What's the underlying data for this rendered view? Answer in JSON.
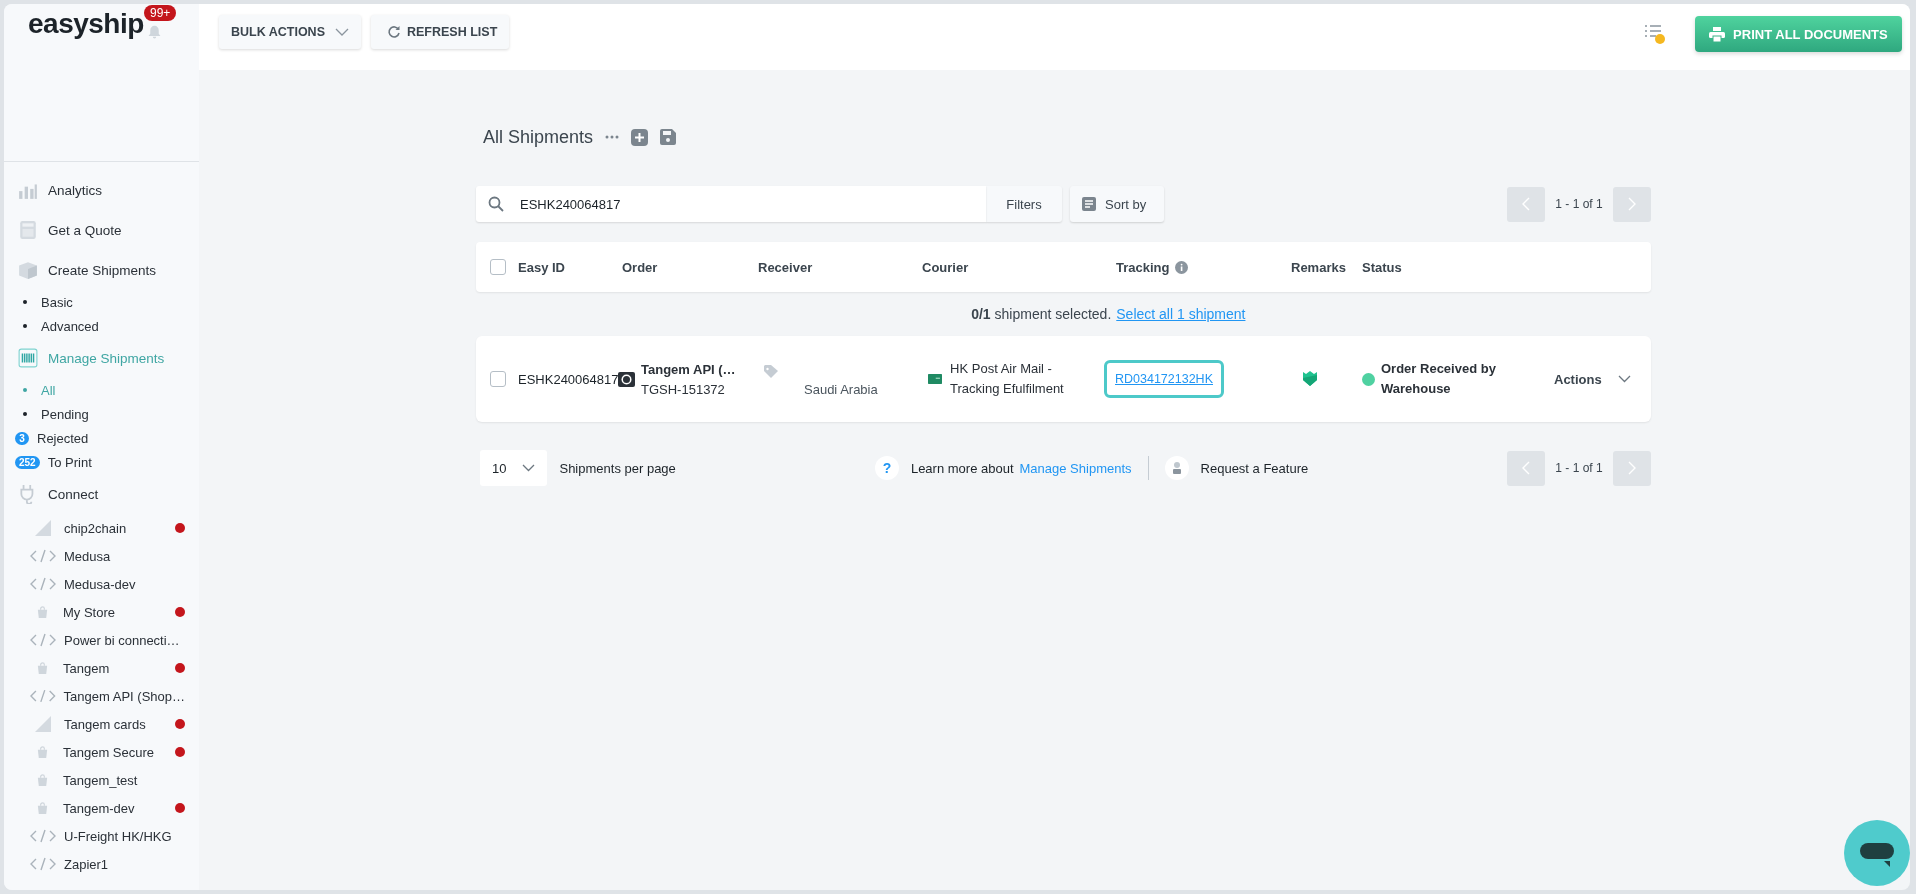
{
  "brand": {
    "logo": "easyship",
    "notification_badge": "99+"
  },
  "toolbar": {
    "buttons": [
      {
        "label": "BULK ACTIONS",
        "kind": "dropdown"
      },
      {
        "label": "REFRESH LIST",
        "kind": "refresh"
      }
    ],
    "print_button": "PRINT ALL DOCUMENTS"
  },
  "sidebar": {
    "nav": [
      {
        "label": "Analytics",
        "kind": "section",
        "selected": false
      },
      {
        "label": "Get a Quote",
        "kind": "section",
        "selected": false
      },
      {
        "label": "Create Shipments",
        "kind": "section",
        "selected": false
      },
      {
        "label": "Basic",
        "kind": "sub",
        "selected": false
      },
      {
        "label": "Advanced",
        "kind": "sub",
        "selected": false
      },
      {
        "label": "Manage Shipments",
        "kind": "section",
        "selected": true
      },
      {
        "label": "All",
        "kind": "sub",
        "selected": true
      },
      {
        "label": "Pending",
        "kind": "sub",
        "selected": false
      },
      {
        "label": "Rejected",
        "kind": "sub",
        "badge": "3",
        "selected": false
      },
      {
        "label": "To Print",
        "kind": "sub",
        "badge": "252",
        "selected": false
      },
      {
        "label": "Connect",
        "kind": "section",
        "selected": false
      }
    ],
    "stores": [
      {
        "name": "chip2chain",
        "kind": "bigcommerce",
        "alert": true
      },
      {
        "name": "Medusa",
        "kind": "api",
        "alert": false
      },
      {
        "name": "Medusa-dev",
        "kind": "api",
        "alert": false
      },
      {
        "name": "My Store",
        "kind": "shopify",
        "alert": true
      },
      {
        "name": "Power bi connecti…",
        "kind": "api",
        "alert": false
      },
      {
        "name": "Tangem",
        "kind": "shopify",
        "alert": true
      },
      {
        "name": "Tangem API (Shop…",
        "kind": "api",
        "alert": false
      },
      {
        "name": "Tangem cards",
        "kind": "bigcommerce",
        "alert": true
      },
      {
        "name": "Tangem Secure",
        "kind": "shopify",
        "alert": true
      },
      {
        "name": "Tangem_test",
        "kind": "shopify",
        "alert": false
      },
      {
        "name": "Tangem-dev",
        "kind": "shopify",
        "alert": true
      },
      {
        "name": "U-Freight HK/HKG",
        "kind": "api",
        "alert": false
      },
      {
        "name": "Zapier1",
        "kind": "api",
        "alert": false
      }
    ]
  },
  "page": {
    "title": "All Shipments",
    "search": {
      "value": "ESHK240064817",
      "filters": "Filters",
      "sort": "Sort by"
    },
    "pagination_top": "1 - 1 of 1",
    "table": {
      "all_checked": false,
      "columns": [
        "Easy ID",
        "Order",
        "Receiver",
        "Courier",
        "Tracking",
        "Remarks",
        "Status"
      ],
      "selection_summary": "**0/1** shipment selected.",
      "select_all_link": "Select all 1 shipment",
      "rows": [
        {
          "selected": false,
          "easy_id": "ESHK240064817",
          "store": "Tangem API (…",
          "order_id": "TGSH-151372",
          "receiver": "Saudi Arabia",
          "courier": "HK Post Air Mail - Tracking Efulfilment",
          "tracking": "RD034172132HK",
          "status": "Order Received by Warehouse",
          "color": "#4fd1a1",
          "actions": "Actions"
        }
      ]
    },
    "footer": {
      "per_page": "10",
      "per_page_label": "Shipments per page",
      "help_icon": "?",
      "learn_more": "Learn more about",
      "learn_more_link": "Manage Shipments",
      "request_feature": "Request a Feature",
      "pagination": "1 - 1 of 1"
    }
  }
}
